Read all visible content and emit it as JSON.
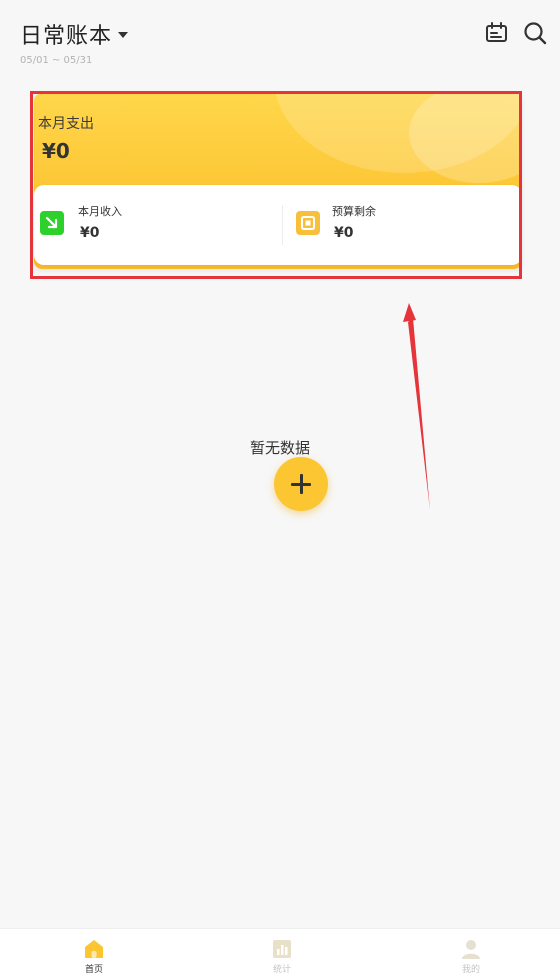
{
  "header": {
    "book_title": "日常账本",
    "date_range": "05/01 ~ 05/31",
    "icons": {
      "calendar": "calendar-icon",
      "search": "search-icon"
    }
  },
  "summary": {
    "expense_label": "本月支出",
    "expense_value": "¥0",
    "income_label": "本月收入",
    "income_value": "¥0",
    "budget_label": "预算剩余",
    "budget_value": "¥0"
  },
  "empty": {
    "text": "暂无数据"
  },
  "tabbar": {
    "tabs": [
      {
        "label": "首页",
        "icon": "home-icon",
        "active": true
      },
      {
        "label": "统计",
        "icon": "chart-icon",
        "active": false
      },
      {
        "label": "我的",
        "icon": "user-icon",
        "active": false
      }
    ]
  },
  "colors": {
    "accent": "#fcc532",
    "income_icon": "#2ed12c",
    "budget_icon": "#f8c03a",
    "highlight": "#e5343a",
    "background": "#f7f7f7"
  }
}
